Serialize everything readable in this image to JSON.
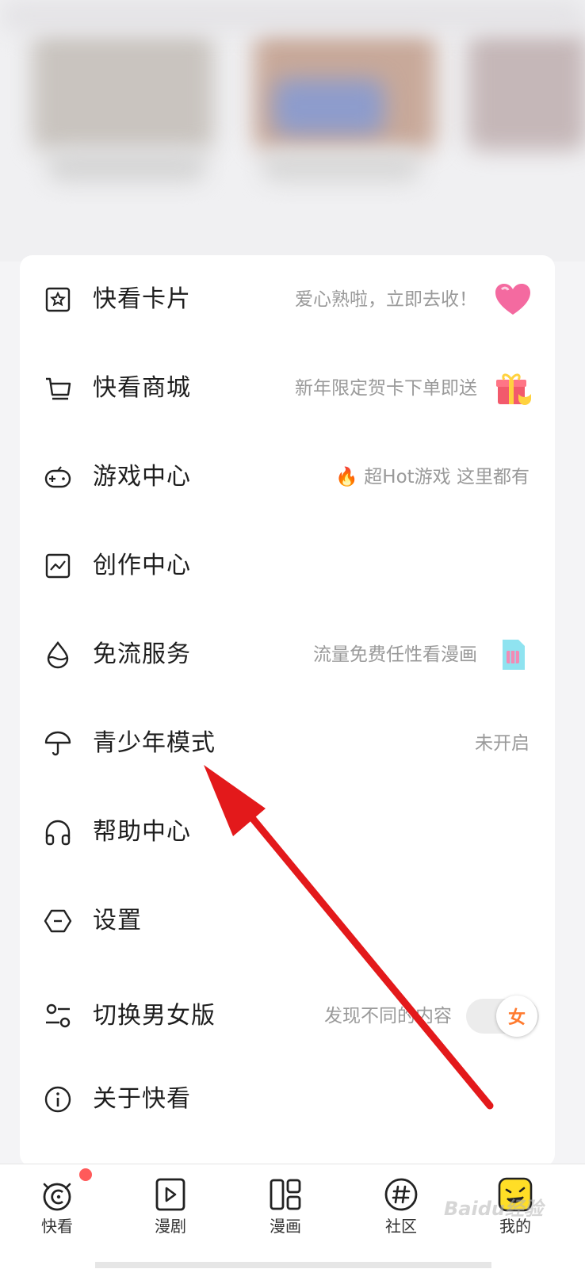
{
  "menu": [
    {
      "label": "快看卡片",
      "hint": "爱心熟啦，立即去收！",
      "icon": "card-star-icon",
      "emoji": "heart"
    },
    {
      "label": "快看商城",
      "hint": "新年限定贺卡下单即送",
      "icon": "cart-icon",
      "emoji": "gift"
    },
    {
      "label": "游戏中心",
      "hint": "超Hot游戏 这里都有",
      "icon": "gamepad-icon",
      "hint_prefix": "🔥"
    },
    {
      "label": "创作中心",
      "hint": "",
      "icon": "chart-icon"
    },
    {
      "label": "免流服务",
      "hint": "流量免费任性看漫画",
      "icon": "drop-icon",
      "emoji": "sim-card"
    },
    {
      "label": "青少年模式",
      "hint": "未开启",
      "icon": "umbrella-icon"
    },
    {
      "label": "帮助中心",
      "hint": "",
      "icon": "headphones-icon"
    },
    {
      "label": "设置",
      "hint": "",
      "icon": "hexagon-settings-icon"
    },
    {
      "label": "切换男女版",
      "hint": "发现不同的内容",
      "icon": "switch-icon",
      "toggle_label": "女"
    },
    {
      "label": "关于快看",
      "hint": "",
      "icon": "info-icon"
    }
  ],
  "nav": [
    {
      "label": "快看",
      "icon": "kuaikan-home-icon",
      "badge": true
    },
    {
      "label": "漫剧",
      "icon": "play-icon"
    },
    {
      "label": "漫画",
      "icon": "grid-layout-icon"
    },
    {
      "label": "社区",
      "icon": "hashtag-icon"
    },
    {
      "label": "我的",
      "icon": "face-avatar-icon",
      "active": true
    }
  ],
  "watermark": "Baidu经验",
  "colors": {
    "accent": "#ffde26",
    "arrow": "#e3191b",
    "hint": "#9a9a9a",
    "badge": "#ff5a5a"
  }
}
